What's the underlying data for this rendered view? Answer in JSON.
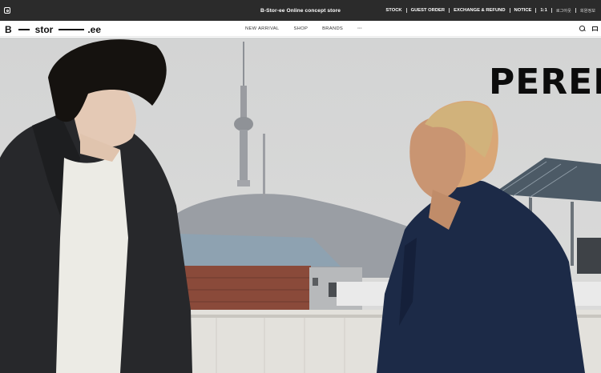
{
  "topbar": {
    "announcement": "B-Stor-ee Online concept store",
    "utility": [
      {
        "label": "STOCK"
      },
      {
        "label": "GUEST ORDER"
      },
      {
        "label": "EXCHANGE & REFUND"
      },
      {
        "label": "NOTICE"
      },
      {
        "label": "1:1"
      },
      {
        "label": "로그아웃"
      },
      {
        "label": "회원정보"
      }
    ]
  },
  "header": {
    "logo": {
      "b": "B",
      "stor": "stor",
      "ee": ".ee"
    },
    "nav": [
      {
        "label": "NEW ARRIVAL"
      },
      {
        "label": "SHOP"
      },
      {
        "label": "BRANDS"
      },
      {
        "label": "···"
      }
    ]
  },
  "hero": {
    "headline": "PEREI"
  },
  "icons": {
    "instagram": "instagram-icon",
    "search": "search-icon",
    "cart": "cart-icon"
  }
}
